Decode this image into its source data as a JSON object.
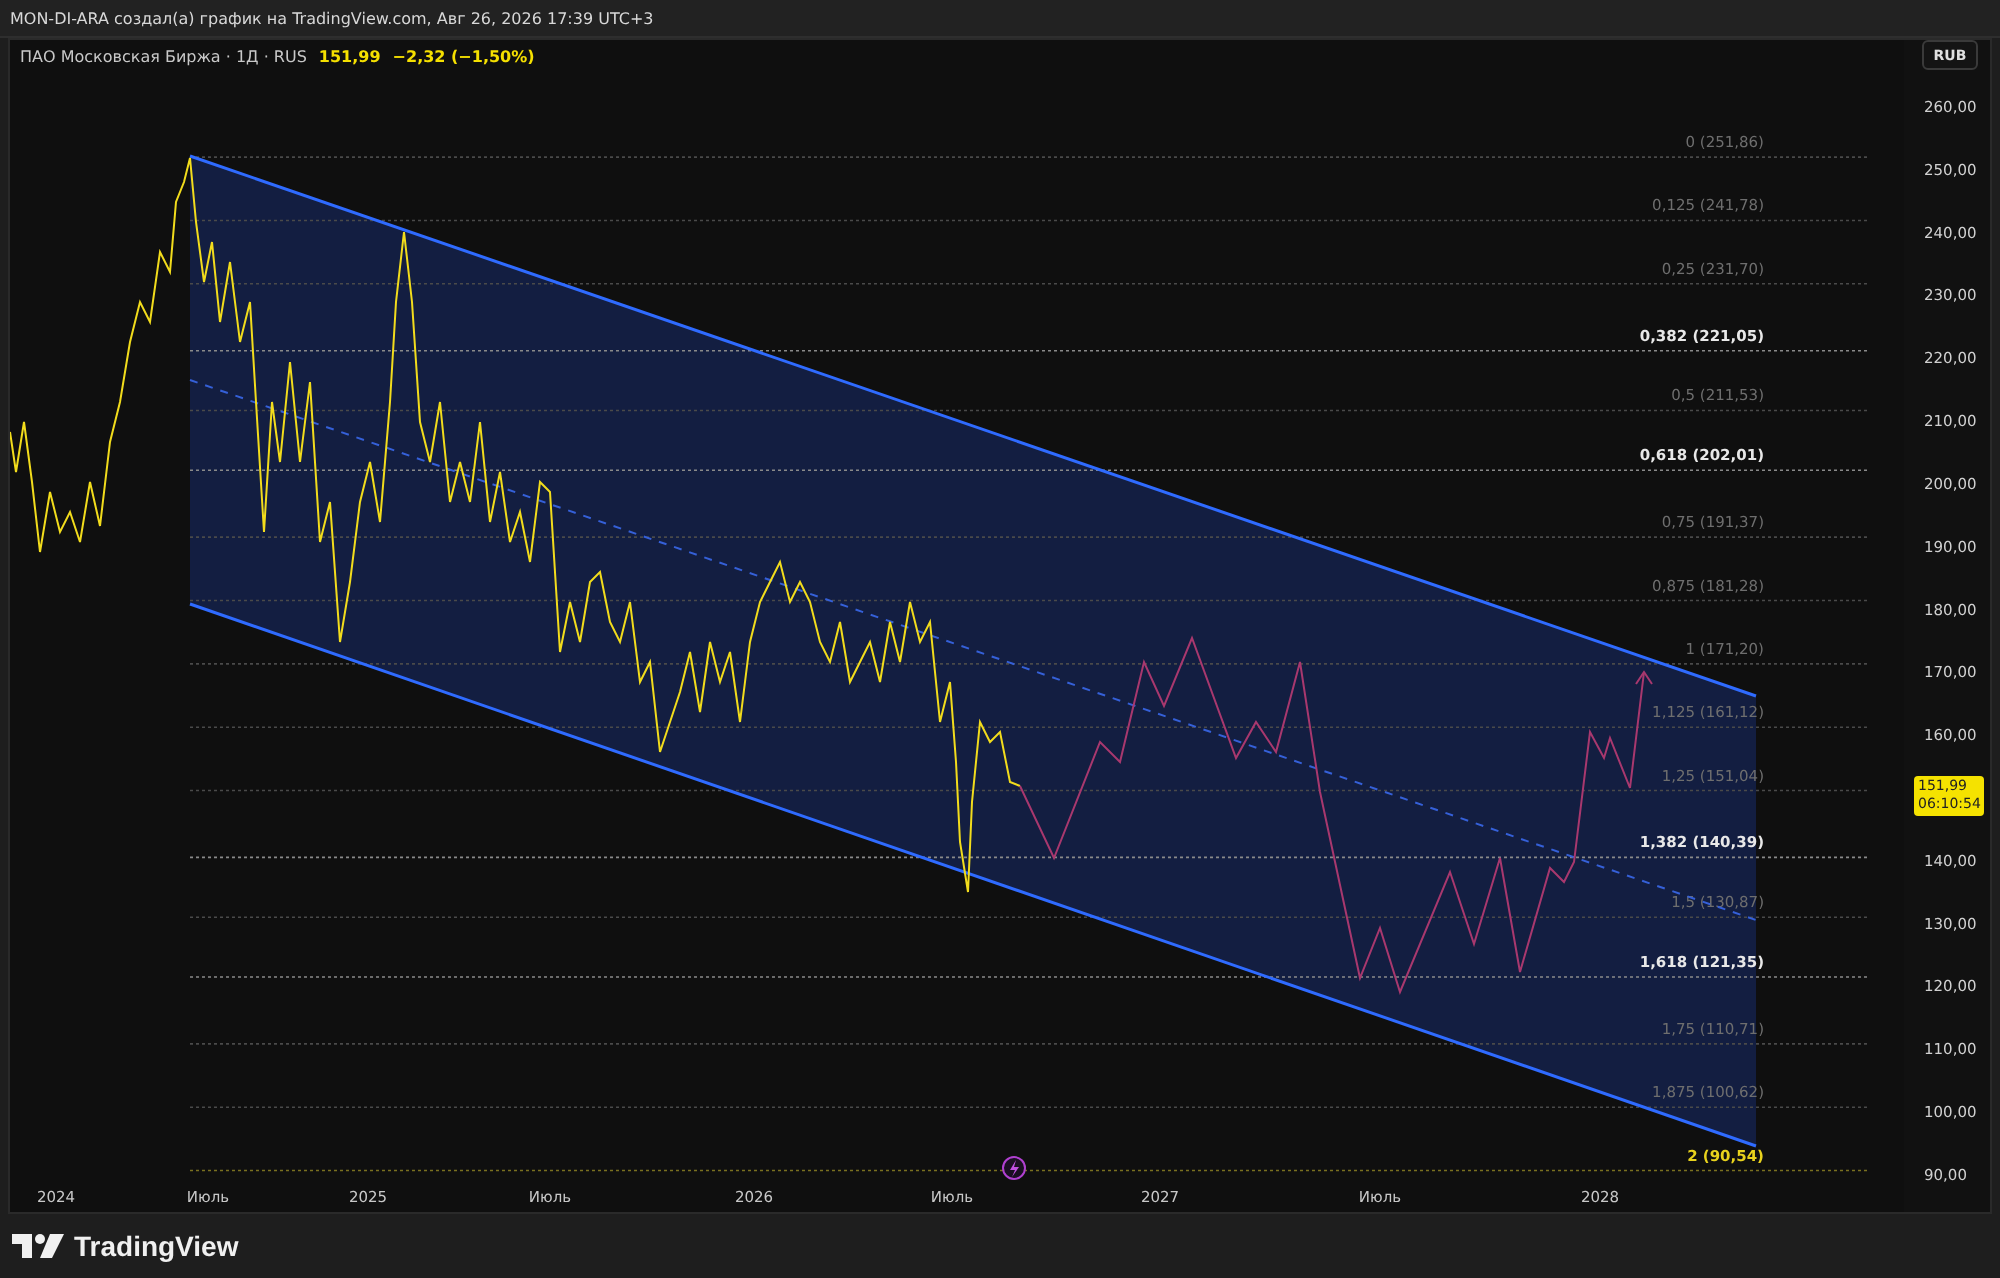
{
  "header": {
    "text": "MON-DI-ARA создал(а) график на TradingView.com, Авг 26, 2026 17:39 UTC+3"
  },
  "legend": {
    "symbol": "ПАО Московская Биржа · 1Д · RUS",
    "price": "151,99",
    "change": "−2,32 (−1,50%)"
  },
  "currency_button": "RUB",
  "price_axis": [
    "260,00",
    "250,00",
    "240,00",
    "230,00",
    "220,00",
    "210,00",
    "200,00",
    "190,00",
    "180,00",
    "170,00",
    "160,00",
    "140,00",
    "130,00",
    "120,00",
    "110,00",
    "100,00",
    "90,00"
  ],
  "time_axis": [
    "2024",
    "Июль",
    "2025",
    "Июль",
    "2026",
    "Июль",
    "2027",
    "Июль",
    "2028"
  ],
  "fib_levels": [
    {
      "label": "0 (251,86)",
      "kind": "muted"
    },
    {
      "label": "0,125 (241,78)",
      "kind": "muted"
    },
    {
      "label": "0,25 (231,70)",
      "kind": "muted"
    },
    {
      "label": "0,382 (221,05)",
      "kind": "bold"
    },
    {
      "label": "0,5 (211,53)",
      "kind": "muted"
    },
    {
      "label": "0,618 (202,01)",
      "kind": "bold"
    },
    {
      "label": "0,75 (191,37)",
      "kind": "muted"
    },
    {
      "label": "0,875 (181,28)",
      "kind": "muted"
    },
    {
      "label": "1 (171,20)",
      "kind": "muted"
    },
    {
      "label": "1,125 (161,12)",
      "kind": "muted"
    },
    {
      "label": "1,25 (151,04)",
      "kind": "muted"
    },
    {
      "label": "1,382 (140,39)",
      "kind": "bold"
    },
    {
      "label": "1,5 (130,87)",
      "kind": "muted"
    },
    {
      "label": "1,618 (121,35)",
      "kind": "bold"
    },
    {
      "label": "1,75 (110,71)",
      "kind": "muted"
    },
    {
      "label": "1,875 (100,62)",
      "kind": "muted"
    },
    {
      "label": "2 (90,54)",
      "kind": "accent"
    }
  ],
  "price_badge": {
    "price": "151,99",
    "countdown": "06:10:54"
  },
  "footer": {
    "logo_text": "TradingView"
  }
}
